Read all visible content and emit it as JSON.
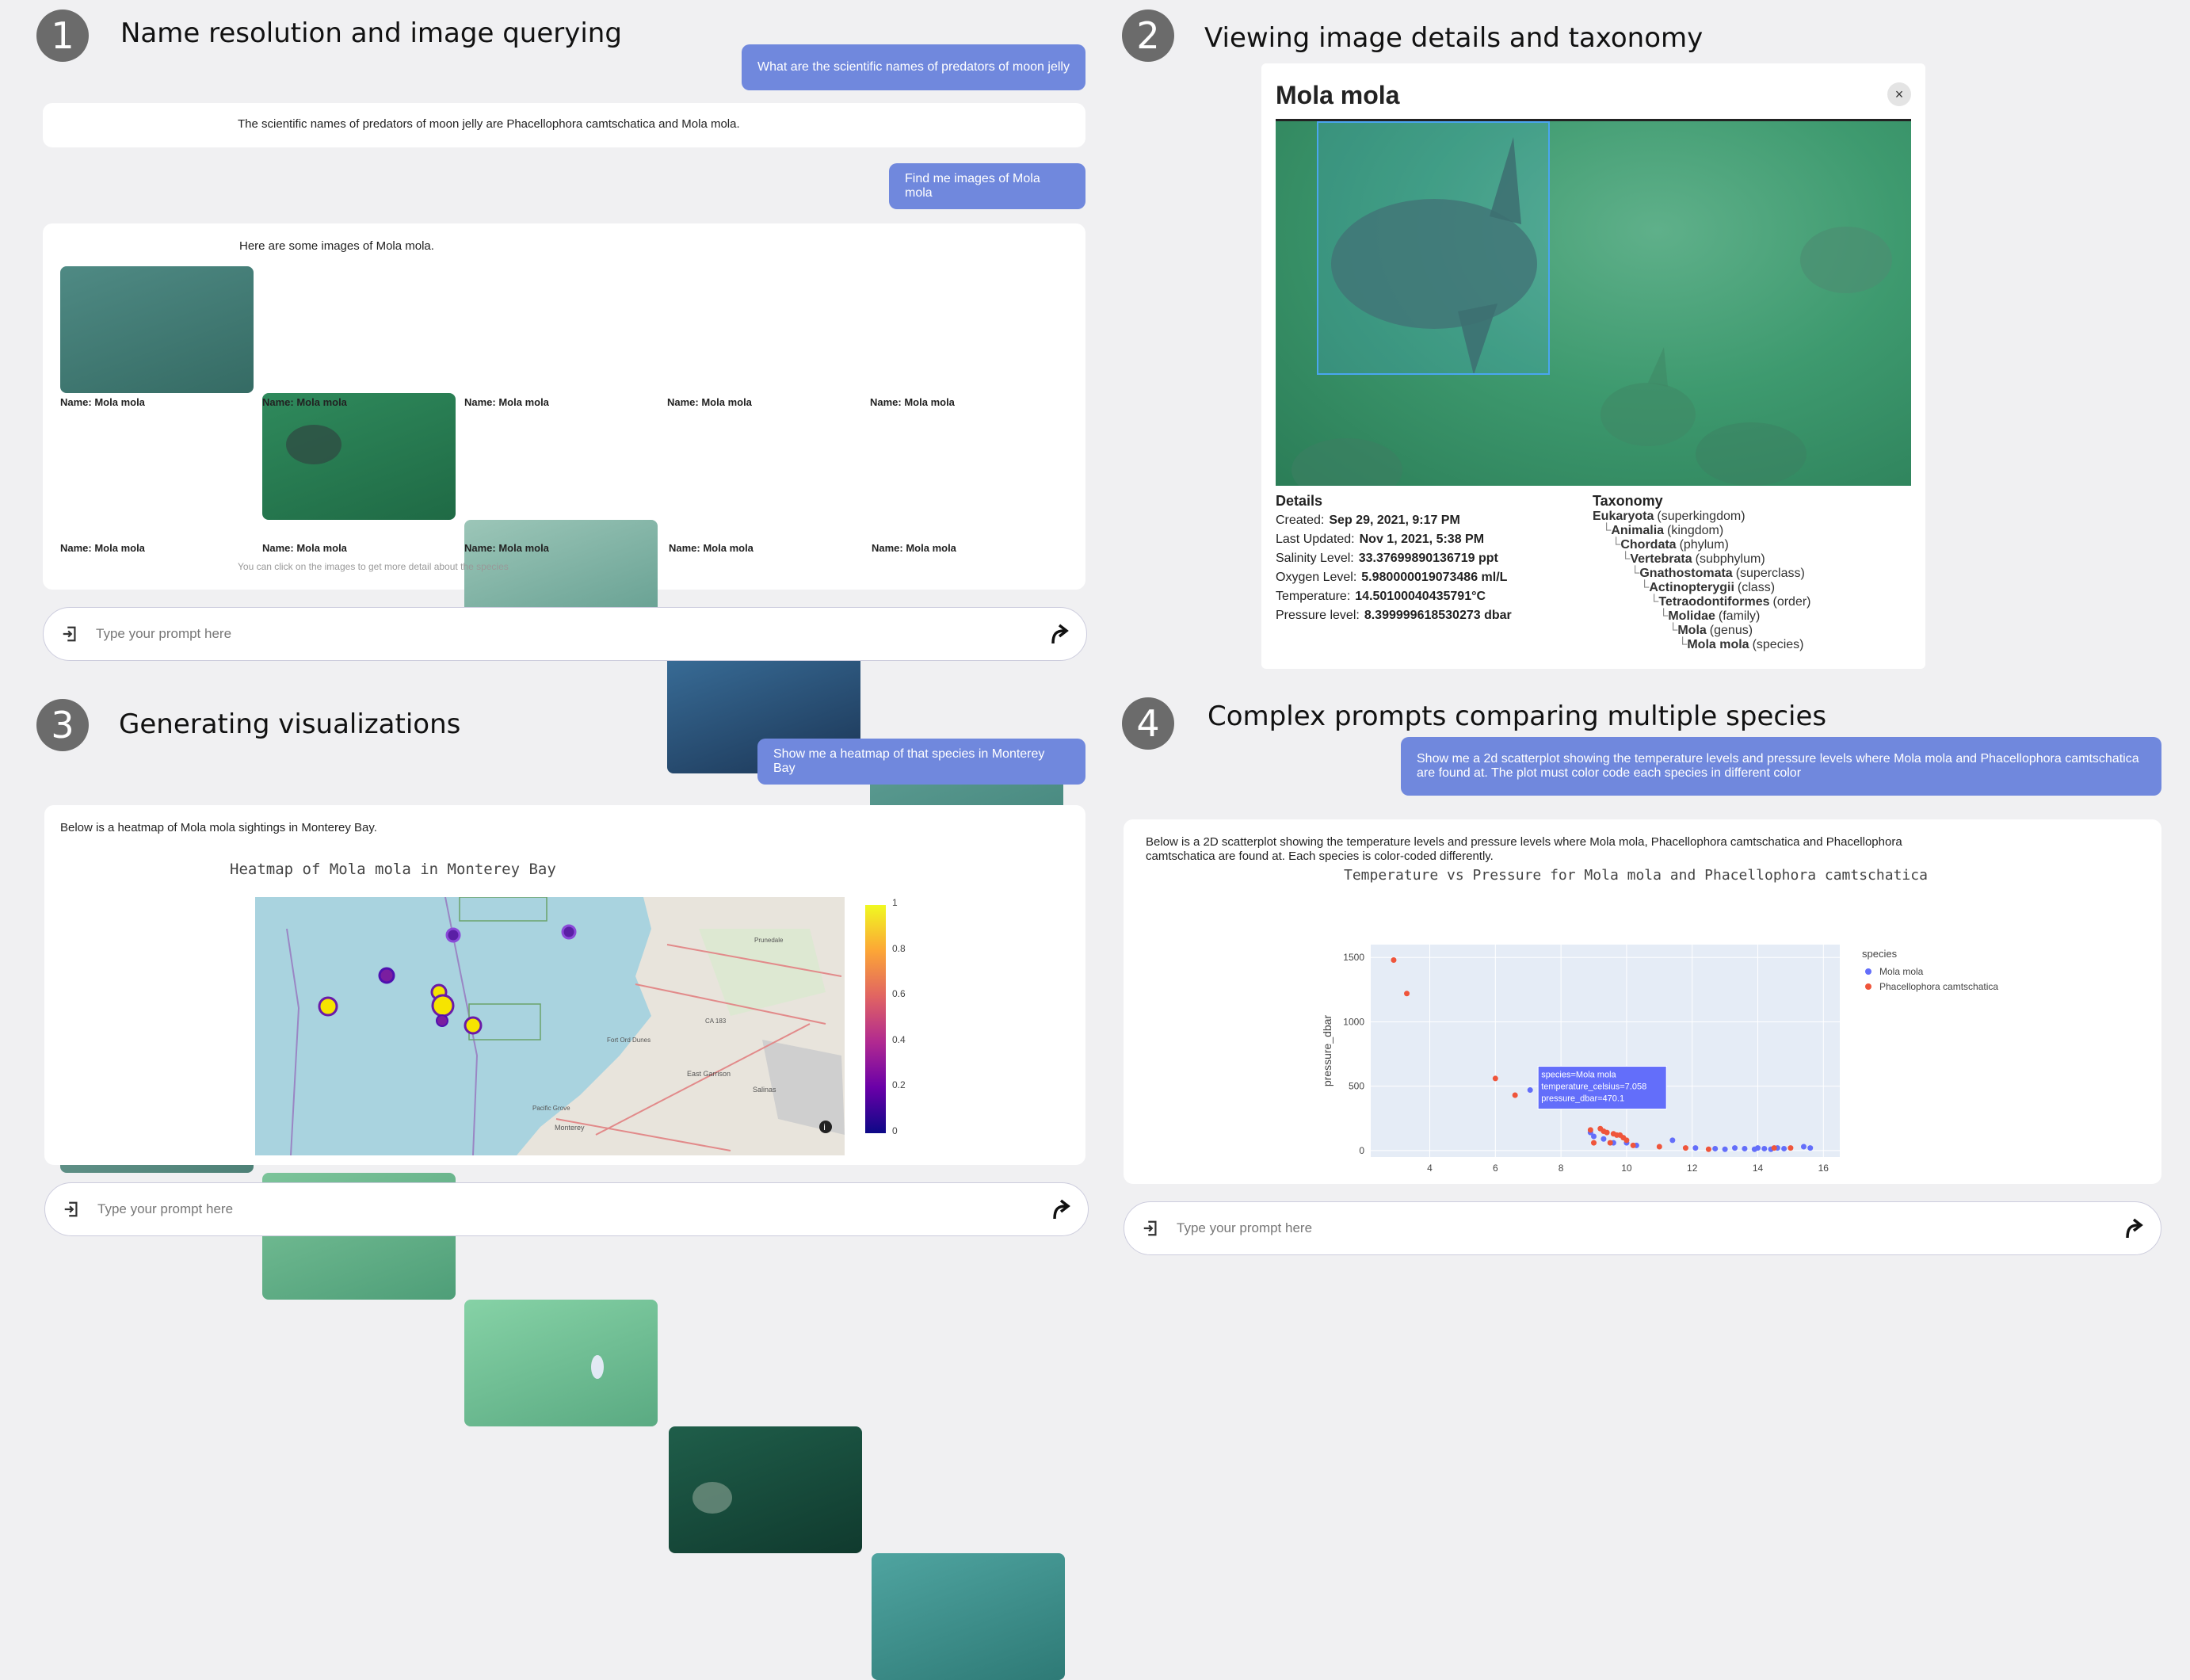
{
  "panels": [
    {
      "number": "1",
      "title": "Name resolution and image querying"
    },
    {
      "number": "2",
      "title": "Viewing image details and taxonomy"
    },
    {
      "number": "3",
      "title": "Generating visualizations"
    },
    {
      "number": "4",
      "title": "Complex prompts comparing multiple species"
    }
  ],
  "p1": {
    "q1": "What are the scientific names of predators of moon jelly",
    "a1": "The scientific names of predators of moon jelly are Phacellophora camtschatica and Mola mola.",
    "q2": "Find me images of Mola mola",
    "a2": "Here are some images of Mola mola.",
    "captions": [
      "Name: Mola mola",
      "Name: Mola mola",
      "Name: Mola mola",
      "Name: Mola mola",
      "Name: Mola mola",
      "Name: Mola mola",
      "Name: Mola mola",
      "Name: Mola mola",
      "Name: Mola mola",
      "Name: Mola mola"
    ],
    "hint": "You can click on the images to get more detail about the species",
    "prompt_placeholder": "Type your prompt here"
  },
  "p2": {
    "title": "Mola mola",
    "details_heading": "Details",
    "details": [
      {
        "label": "Created:",
        "value": "Sep 29, 2021, 9:17 PM"
      },
      {
        "label": "Last Updated:",
        "value": "Nov 1, 2021, 5:38 PM"
      },
      {
        "label": "Salinity Level:",
        "value": "33.37699890136719 ppt"
      },
      {
        "label": "Oxygen Level:",
        "value": "5.980000019073486 ml/L"
      },
      {
        "label": "Temperature:",
        "value": "14.50100040435791°C"
      },
      {
        "label": "Pressure level:",
        "value": "8.399999618530273 dbar"
      }
    ],
    "taxonomy_heading": "Taxonomy",
    "taxonomy": [
      {
        "name": "Eukaryota",
        "rank": "(superkingdom)"
      },
      {
        "name": "Animalia",
        "rank": "(kingdom)"
      },
      {
        "name": "Chordata",
        "rank": "(phylum)"
      },
      {
        "name": "Vertebrata",
        "rank": "(subphylum)"
      },
      {
        "name": "Gnathostomata",
        "rank": "(superclass)"
      },
      {
        "name": "Actinopterygii",
        "rank": "(class)"
      },
      {
        "name": "Tetraodontiformes",
        "rank": "(order)"
      },
      {
        "name": "Molidae",
        "rank": "(family)"
      },
      {
        "name": "Mola",
        "rank": "(genus)"
      },
      {
        "name": "Mola mola",
        "rank": "(species)"
      }
    ]
  },
  "p3": {
    "q": "Show me a heatmap of that species in Monterey Bay",
    "a": "Below is a heatmap of Mola mola sightings in Monterey Bay.",
    "chart_title": "Heatmap of Mola mola in Monterey Bay",
    "colorbar_ticks": [
      "1",
      "0.8",
      "0.6",
      "0.4",
      "0.2",
      "0"
    ],
    "map_labels": [
      "Salinas",
      "East Garrison",
      "Monterey",
      "Pacific Grove",
      "Prunedale",
      "Fort Ord Dunes",
      "CA 183"
    ],
    "prompt_placeholder": "Type your prompt here"
  },
  "p4": {
    "q": "Show me a 2d scatterplot showing the temperature levels and pressure levels where Mola mola and Phacellophora camtschatica are found at. The plot must color code each species in different color",
    "a": "Below is a 2D scatterplot showing the temperature levels and pressure levels where Mola mola, Phacellophora camtschatica and Phacellophora camtschatica are found at. Each species is color-coded differently.",
    "tooltip": [
      "species=Mola mola",
      "temperature_celsius=7.058",
      "pressure_dbar=470.1"
    ],
    "prompt_placeholder": "Type your prompt here"
  },
  "chart_data": {
    "type": "scatter",
    "title": "Temperature vs Pressure for Mola mola and Phacellophora camtschatica",
    "xlabel": "temperature_celsius",
    "ylabel": "pressure_dbar",
    "xlim": [
      2.2,
      16.5
    ],
    "ylim": [
      -50,
      1600
    ],
    "xticks": [
      4,
      6,
      8,
      10,
      12,
      14,
      16
    ],
    "yticks": [
      0,
      500,
      1000,
      1500
    ],
    "legend_title": "species",
    "legend_position": "right",
    "series": [
      {
        "name": "Mola mola",
        "color": "#636efa",
        "x": [
          7.06,
          8.9,
          9.0,
          9.3,
          9.6,
          10.0,
          10.3,
          11.4,
          12.1,
          12.7,
          13.0,
          13.3,
          13.6,
          13.9,
          14.0,
          14.2,
          14.4,
          14.6,
          14.8,
          15.4,
          15.6
        ],
        "y": [
          470,
          140,
          110,
          90,
          60,
          60,
          40,
          80,
          20,
          15,
          10,
          20,
          15,
          10,
          20,
          15,
          10,
          20,
          15,
          30,
          20
        ]
      },
      {
        "name": "Phacellophora camtschatica",
        "color": "#ef553b",
        "x": [
          2.9,
          3.3,
          6.0,
          6.6,
          8.9,
          9.0,
          9.2,
          9.3,
          9.4,
          9.5,
          9.6,
          9.7,
          9.8,
          9.9,
          10.0,
          10.2,
          11.0,
          11.8,
          12.5,
          14.5,
          15.0
        ],
        "y": [
          1480,
          1220,
          560,
          430,
          160,
          60,
          170,
          150,
          140,
          60,
          130,
          120,
          120,
          100,
          80,
          40,
          30,
          20,
          10,
          20,
          20
        ]
      }
    ]
  }
}
